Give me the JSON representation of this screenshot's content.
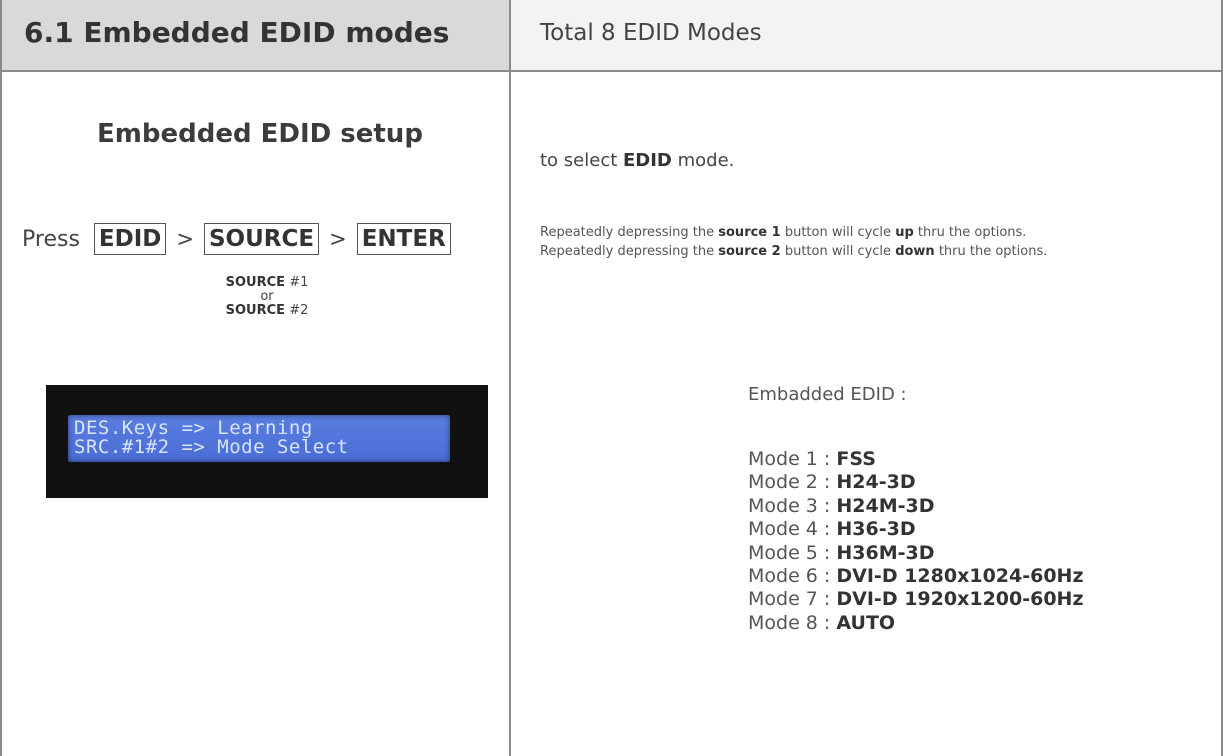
{
  "header": {
    "section_title": "6.1  Embedded EDID modes",
    "section_subtitle": "Total 8 EDID Modes"
  },
  "left": {
    "setup_heading": "Embedded EDID setup",
    "press_label": "Press",
    "keys": [
      "EDID",
      "SOURCE",
      "ENTER"
    ],
    "separator": ">",
    "source_note": {
      "line1_key": "SOURCE",
      "line1_num": "#1",
      "or": "or",
      "line2_key": "SOURCE",
      "line2_num": "#2"
    },
    "lcd": {
      "line1": "DES.Keys => Learning",
      "line2": "SRC.#1#2 => Mode Select"
    }
  },
  "right": {
    "instruction": {
      "pre": "to select ",
      "bold": "EDID",
      "post": " mode."
    },
    "cycle_up": {
      "pre": "Repeatedly depressing the ",
      "button": "source 1",
      "mid": " button will cycle ",
      "direction": "up",
      "post": " thru the options."
    },
    "cycle_down": {
      "pre": "Repeatedly depressing the ",
      "button": "source 2",
      "mid": " button will cycle ",
      "direction": "down",
      "post": " thru the options."
    },
    "modes_heading": "Embadded EDID :",
    "modes": [
      {
        "label": "Mode 1 : ",
        "value": "FSS"
      },
      {
        "label": "Mode 2 : ",
        "value": "H24-3D"
      },
      {
        "label": "Mode 3 : ",
        "value": "H24M-3D"
      },
      {
        "label": "Mode 4 : ",
        "value": "H36-3D"
      },
      {
        "label": "Mode 5 : ",
        "value": "H36M-3D"
      },
      {
        "label": "Mode 6 : ",
        "value": "DVI-D 1280x1024-60Hz"
      },
      {
        "label": "Mode 7 : ",
        "value": "DVI-D 1920x1200-60Hz"
      },
      {
        "label": "Mode 8 : ",
        "value": "AUTO"
      }
    ]
  },
  "colors": {
    "header_left_bg": "#d9d9d9",
    "header_right_bg": "#f3f3f3",
    "border": "#8a8a8a",
    "lcd_bg": "#4a6dd6",
    "lcd_text": "#d8e4ff"
  }
}
